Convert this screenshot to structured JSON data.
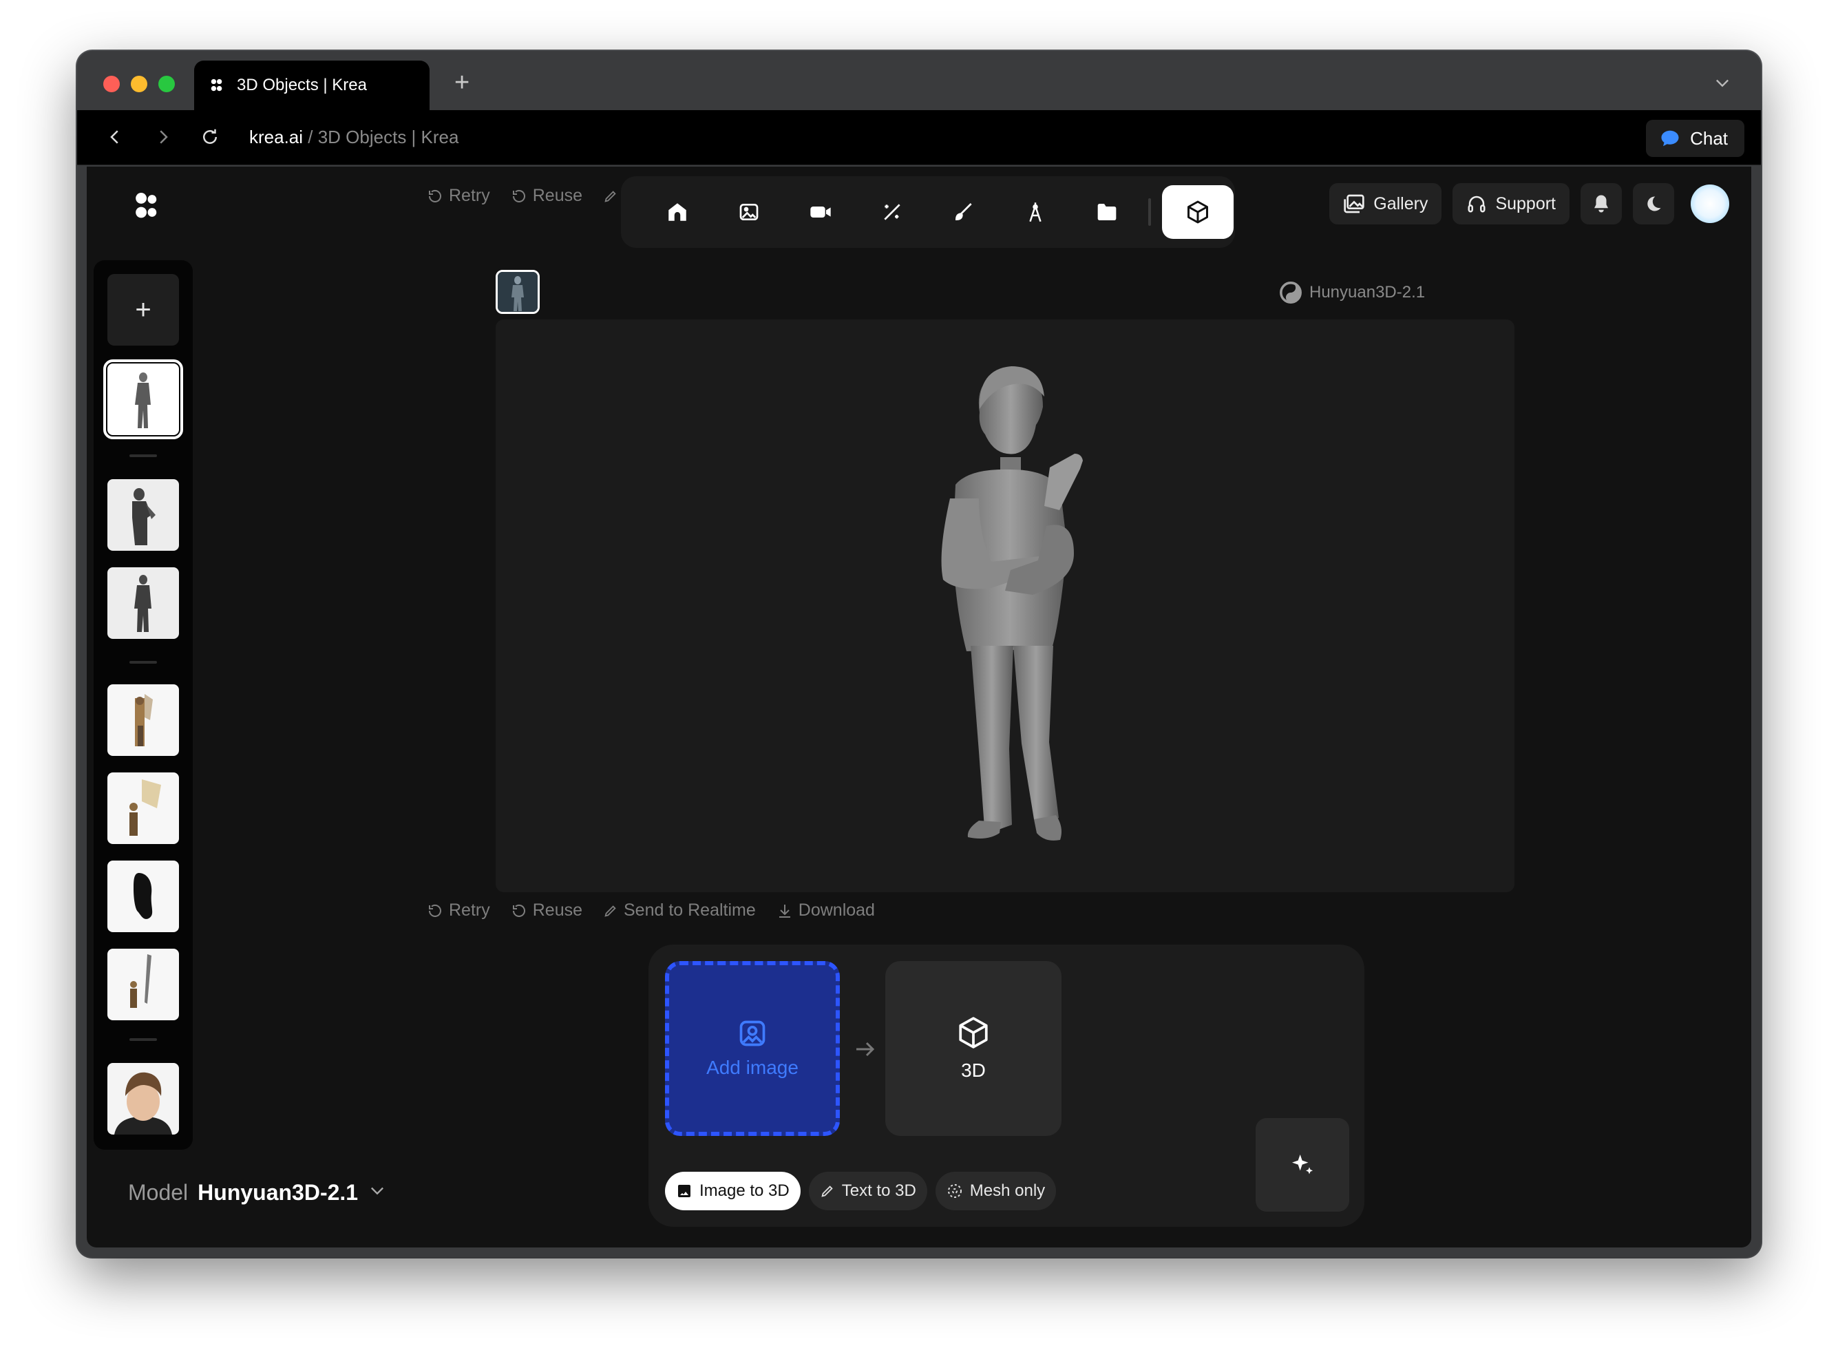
{
  "browser": {
    "tab_title": "3D Objects | Krea",
    "url_domain": "krea.ai",
    "url_sep": " / ",
    "url_page": "3D Objects | Krea",
    "chat_label": "Chat"
  },
  "header": {
    "actions": [
      {
        "label": "Retry",
        "icon": "retry-icon"
      },
      {
        "label": "Reuse",
        "icon": "reuse-icon"
      },
      {
        "label": "S",
        "icon": "pen-icon"
      }
    ],
    "toolbar_tools": [
      "home-icon",
      "image-icon",
      "video-icon",
      "enhance-wand-icon",
      "edit-brush-icon",
      "train-icon",
      "folder-icon",
      "cube-icon"
    ],
    "active_tool": "cube-icon",
    "gallery_label": "Gallery",
    "support_label": "Support"
  },
  "sidebar": {
    "add_label": "+",
    "model_label": "Model",
    "model_value": "Hunyuan3D-2.1"
  },
  "viewer": {
    "model_tag": "Hunyuan3D-2.1"
  },
  "result_actions": [
    {
      "label": "Retry",
      "icon": "retry-icon"
    },
    {
      "label": "Reuse",
      "icon": "reuse-icon"
    },
    {
      "label": "Send to Realtime",
      "icon": "pen-icon"
    },
    {
      "label": "Download",
      "icon": "download-icon"
    }
  ],
  "composer": {
    "add_image_label": "Add image",
    "output_label": "3D",
    "modes": [
      {
        "label": "Image to 3D",
        "icon": "image-icon",
        "active": true
      },
      {
        "label": "Text to 3D",
        "icon": "pen-icon",
        "active": false
      },
      {
        "label": "Mesh only",
        "icon": "mesh-icon",
        "active": false
      }
    ]
  },
  "colors": {
    "accent_blue": "#2d55ff",
    "drop_fill": "#1c2f8f",
    "background": "#121212"
  }
}
